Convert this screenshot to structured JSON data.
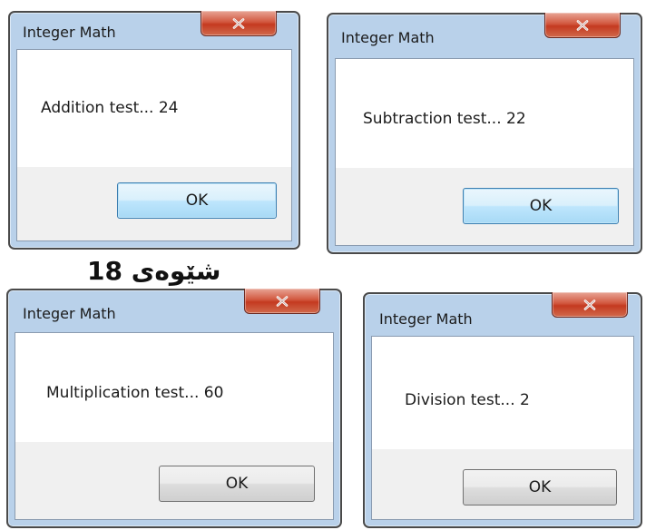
{
  "dialogs": [
    {
      "title": "Integer Math",
      "message": "Addition test... 24",
      "ok_label": "OK",
      "ok_default": true
    },
    {
      "title": "Integer Math",
      "message": "Subtraction test... 22",
      "ok_label": "OK",
      "ok_default": false
    },
    {
      "title": "Integer Math",
      "message": "Multiplication test... 60",
      "ok_label": "OK",
      "ok_default": false
    },
    {
      "title": "Integer Math",
      "message": "Division test... 2",
      "ok_label": "OK",
      "ok_default": false
    }
  ],
  "caption": "شێوەی 18",
  "colors": {
    "frame": "#b9d1ea",
    "close": "#c43a20",
    "ok_default_border": "#3c7fb1"
  },
  "icons": {
    "close": "close-x-icon"
  }
}
